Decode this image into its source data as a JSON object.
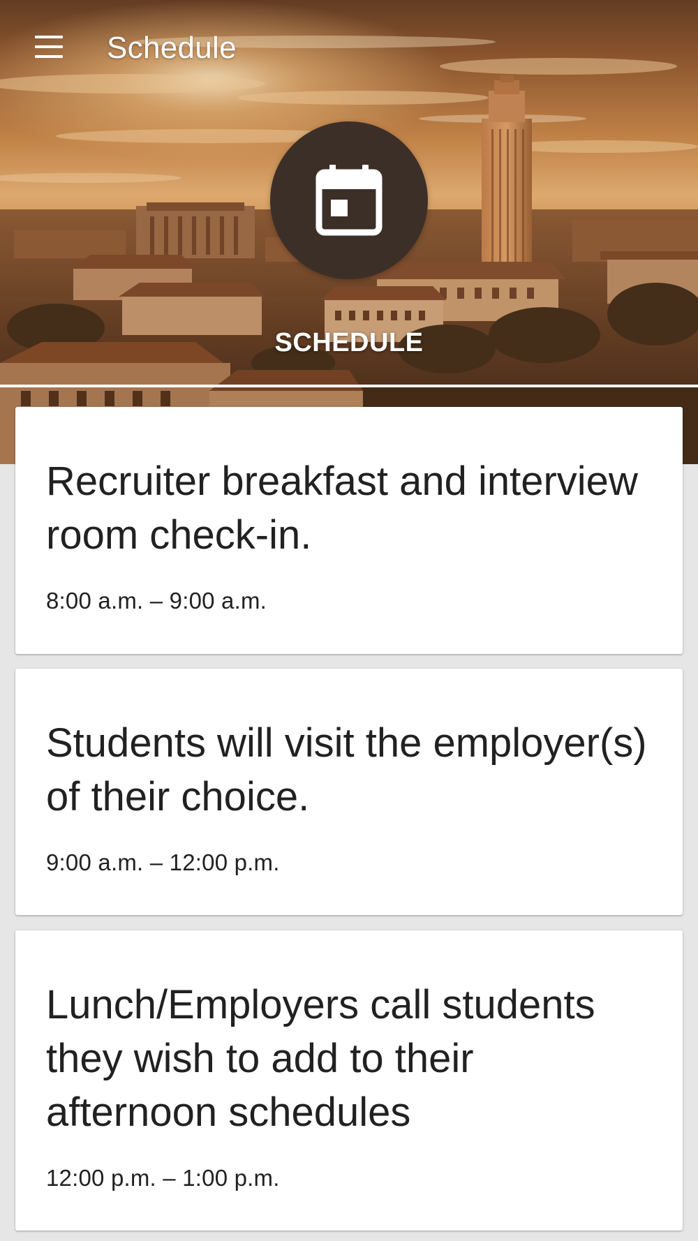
{
  "toolbar": {
    "title": "Schedule",
    "menu_icon": "hamburger-menu-icon"
  },
  "hero": {
    "badge_icon": "calendar-icon",
    "label": "SCHEDULE",
    "badge_color": "#3c2f28"
  },
  "schedule": {
    "items": [
      {
        "title": "Recruiter breakfast and interview room check-in.",
        "time": "8:00 a.m. – 9:00 a.m."
      },
      {
        "title": "Students will visit the employer(s) of their choice.",
        "time": "9:00 a.m. – 12:00 p.m."
      },
      {
        "title": "Lunch/Employers call students they wish to add to their afternoon schedules",
        "time": "12:00 p.m. – 1:00 p.m."
      }
    ]
  },
  "colors": {
    "background": "#e6e6e6",
    "card": "#ffffff",
    "text": "#212121",
    "accent_dark": "#3c2f28"
  }
}
